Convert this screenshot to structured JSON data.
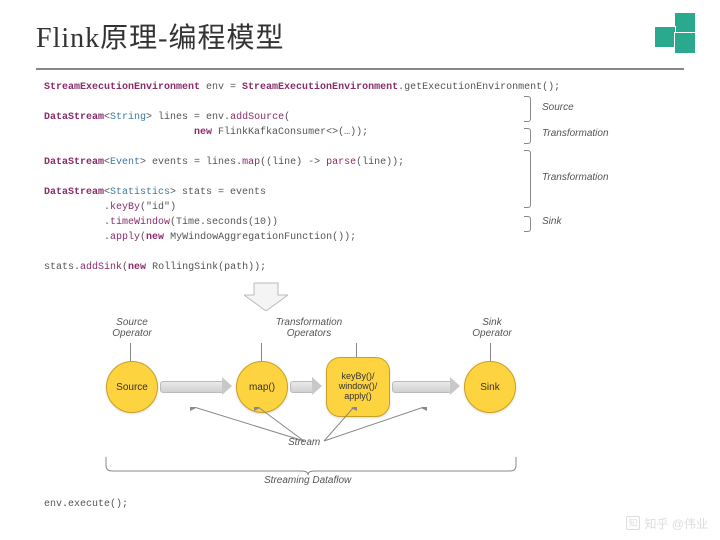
{
  "title": "Flink原理-编程模型",
  "code": {
    "l1a": "StreamExecutionEnvironment",
    "l1b": " env = ",
    "l1c": "StreamExecutionEnvironment",
    "l1d": ".getExecutionEnvironment();",
    "l2a": "DataStream",
    "l2b": "<",
    "l2c": "String",
    "l2d": "> lines = env.",
    "l2e": "addSource",
    "l2f": "(",
    "l3a": "                         ",
    "l3b": "new",
    "l3c": " FlinkKafkaConsumer<>(…));",
    "l4a": "DataStream",
    "l4b": "<",
    "l4c": "Event",
    "l4d": "> events = lines.",
    "l4e": "map",
    "l4f": "((line) -> ",
    "l4g": "parse",
    "l4h": "(line));",
    "l5a": "DataStream",
    "l5b": "<",
    "l5c": "Statistics",
    "l5d": "> stats = events",
    "l6a": "          .",
    "l6b": "keyBy",
    "l6c": "(",
    "l6d": "\"id\"",
    "l6e": ")",
    "l7a": "          .",
    "l7b": "timeWindow",
    "l7c": "(Time.seconds(10))",
    "l8a": "          .",
    "l8b": "apply",
    "l8c": "(",
    "l8d": "new",
    "l8e": " MyWindowAggregationFunction());",
    "l9a": "stats.",
    "l9b": "addSink",
    "l9c": "(",
    "l9d": "new",
    "l9e": " RollingSink(path));"
  },
  "annotations": {
    "source": "Source",
    "t1": "Transformation",
    "t2": "Transformation",
    "sink": "Sink"
  },
  "diagram": {
    "srcOp": "Source\nOperator",
    "tOps": "Transformation\nOperators",
    "sinkOp": "Sink\nOperator",
    "n1": "Source",
    "n2": "map()",
    "n3": "keyBy()/\nwindow()/\napply()",
    "n4": "Sink",
    "stream": "Stream",
    "dataflow": "Streaming Dataflow"
  },
  "exec": "env.execute();",
  "watermark": "知乎 @伟业"
}
